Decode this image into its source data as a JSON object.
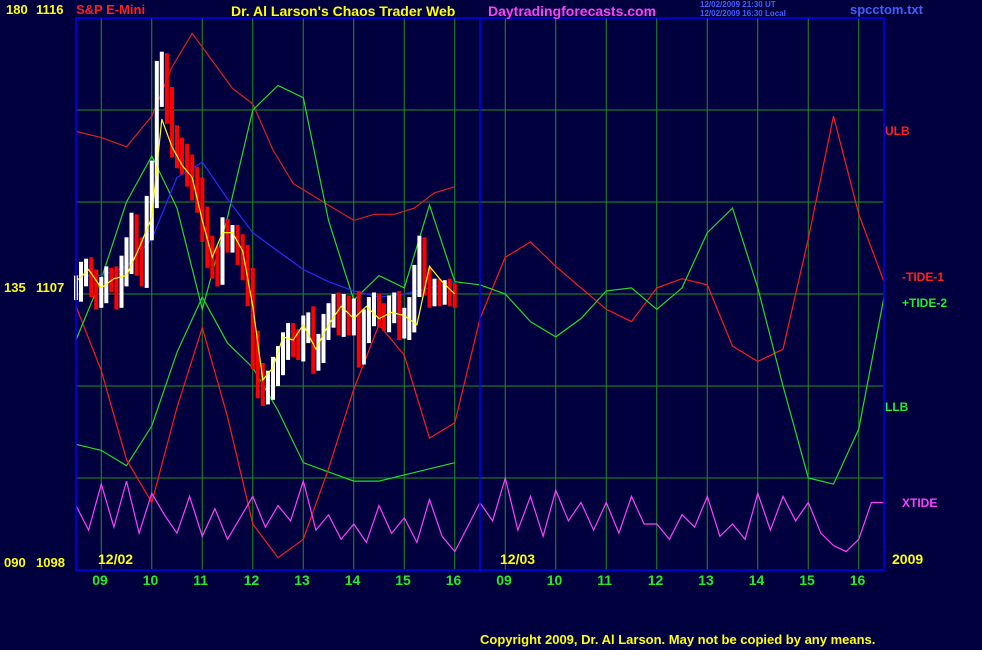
{
  "header": {
    "symbol": "S&P E-Mini",
    "title": "Dr. Al Larson's Chaos Trader Web",
    "site": "Daytradingforecasts.com",
    "timestamp_ut": "12/02/2009 21:30 UT",
    "timestamp_local": "12/02/2009 16:30 Local",
    "file": "spcctom.txt"
  },
  "y_labels": {
    "top_left": "180",
    "top_right": "1116",
    "mid_left": "135",
    "mid_right": "1107",
    "bottom_left": "090",
    "bottom_right": "1098"
  },
  "x_labels": {
    "day1": "12/02",
    "day2": "12/03",
    "year": "2009",
    "hours": [
      "09",
      "10",
      "11",
      "12",
      "13",
      "14",
      "15",
      "16",
      "09",
      "10",
      "11",
      "12",
      "13",
      "14",
      "15",
      "16"
    ]
  },
  "series_labels": {
    "ulb": "ULB",
    "tide1": "-TIDE-1",
    "tide2": "+TIDE-2",
    "llb": "LLB",
    "xtide": "XTIDE"
  },
  "footer": {
    "copyright": "Copyright 2009, Dr. Al Larson. May not be copied by any means."
  },
  "colors": {
    "background": "#00003f",
    "grid": "#1f8f1f",
    "frame": "#0000ff",
    "price_up": "#ffffff",
    "price_down": "#ff0000",
    "avg": "#ffff00",
    "tide1": "#ff1a1a",
    "tide2": "#22dd22",
    "ulb": "#dd2020",
    "llb": "#22dd22",
    "blue_avg": "#2a2aff",
    "xtide": "#ff40ff"
  },
  "chart_data": {
    "type": "line",
    "ylim": [
      1098,
      1116
    ],
    "x_domain_hours": [
      8.5,
      24.5
    ],
    "series": [
      {
        "key": "ulb",
        "name": "ULB",
        "x": [
          8.5,
          9.0,
          9.5,
          10.0,
          10.4,
          10.8,
          11.2,
          11.6,
          12.0,
          12.4,
          12.8,
          13.2,
          13.6,
          14.0,
          14.4,
          14.8,
          15.2,
          15.6,
          16.0
        ],
        "values": [
          1112.3,
          1112.1,
          1111.8,
          1112.8,
          1114.4,
          1115.5,
          1114.6,
          1113.7,
          1113.2,
          1111.7,
          1110.6,
          1110.2,
          1109.8,
          1109.4,
          1109.6,
          1109.6,
          1109.8,
          1110.3,
          1110.5
        ]
      },
      {
        "key": "llb",
        "name": "LLB",
        "x": [
          8.5,
          9.0,
          9.5,
          10.0,
          10.5,
          11.0,
          11.5,
          12.0,
          12.5,
          13.0,
          13.5,
          14.0,
          14.5,
          15.0,
          15.5,
          16.0
        ],
        "values": [
          1102.1,
          1101.9,
          1101.4,
          1102.7,
          1105.1,
          1106.9,
          1105.4,
          1104.6,
          1103.2,
          1101.5,
          1101.2,
          1100.9,
          1100.9,
          1101.1,
          1101.3,
          1101.5
        ]
      },
      {
        "key": "tide1",
        "name": "-TIDE-1",
        "x": [
          8.5,
          9.0,
          9.5,
          10.0,
          10.5,
          11.0,
          11.5,
          12.0,
          12.5,
          13.0,
          13.5,
          14.0,
          14.5,
          15.0,
          15.5,
          16.0,
          16.5,
          17.0,
          17.5,
          18.0,
          18.5,
          19.0,
          19.5,
          20.0,
          20.5,
          21.0,
          21.5,
          22.0,
          22.5,
          23.0,
          23.5,
          24.0,
          24.5
        ],
        "values": [
          1106.6,
          1104.5,
          1101.6,
          1100.2,
          1103.3,
          1105.9,
          1103.0,
          1099.5,
          1098.4,
          1099.0,
          1101.3,
          1103.9,
          1106.0,
          1105.0,
          1102.3,
          1102.8,
          1106.2,
          1108.2,
          1108.7,
          1107.9,
          1107.2,
          1106.5,
          1106.1,
          1107.2,
          1107.5,
          1107.3,
          1105.3,
          1104.8,
          1105.2,
          1108.8,
          1112.8,
          1109.6,
          1107.4
        ]
      },
      {
        "key": "tide2",
        "name": "+TIDE-2",
        "x": [
          8.5,
          9.0,
          9.5,
          10.0,
          10.5,
          11.0,
          11.5,
          12.0,
          12.5,
          13.0,
          13.5,
          14.0,
          14.5,
          15.0,
          15.5,
          16.0,
          16.5,
          17.0,
          17.5,
          18.0,
          18.5,
          19.0,
          19.5,
          20.0,
          20.5,
          21.0,
          21.5,
          22.0,
          22.5,
          23.0,
          23.5,
          24.0,
          24.5
        ],
        "values": [
          1105.5,
          1107.5,
          1110.0,
          1111.5,
          1109.8,
          1106.5,
          1109.5,
          1113.0,
          1113.8,
          1113.4,
          1109.4,
          1106.8,
          1107.6,
          1107.2,
          1109.9,
          1107.4,
          1107.3,
          1107.0,
          1106.1,
          1105.6,
          1106.2,
          1107.1,
          1107.2,
          1106.5,
          1107.2,
          1109.0,
          1109.8,
          1107.2,
          1104.0,
          1101.0,
          1100.8,
          1102.6,
          1106.9
        ]
      },
      {
        "key": "blue",
        "x": [
          8.5,
          9.0,
          9.5,
          10.0,
          10.5,
          11.0,
          11.5,
          12.0,
          12.5,
          13.0,
          13.5,
          14.0,
          14.5,
          15.0,
          15.5,
          16.0
        ],
        "values": [
          1107.6,
          1107.6,
          1107.9,
          1108.8,
          1110.8,
          1111.3,
          1110.1,
          1109.0,
          1108.4,
          1107.8,
          1107.4,
          1107.1,
          1106.9,
          1107.0,
          1107.2,
          1107.4
        ]
      },
      {
        "key": "xtide",
        "name": "XTIDE",
        "x": [
          8.5,
          8.75,
          9.0,
          9.25,
          9.5,
          9.75,
          10.0,
          10.25,
          10.5,
          10.75,
          11.0,
          11.25,
          11.5,
          11.75,
          12.0,
          12.25,
          12.5,
          12.75,
          13.0,
          13.25,
          13.5,
          13.75,
          14.0,
          14.25,
          14.5,
          14.75,
          15.0,
          15.25,
          15.5,
          15.75,
          16.0,
          16.25,
          16.5,
          16.75,
          17.0,
          17.25,
          17.5,
          17.75,
          18.0,
          18.25,
          18.5,
          18.75,
          19.0,
          19.25,
          19.5,
          19.75,
          20.0,
          20.25,
          20.5,
          20.75,
          21.0,
          21.25,
          21.5,
          21.75,
          22.0,
          22.25,
          22.5,
          22.75,
          23.0,
          23.25,
          23.5,
          23.75,
          24.0,
          24.25,
          24.5
        ],
        "values": [
          1100.1,
          1099.3,
          1100.8,
          1099.4,
          1100.9,
          1099.2,
          1100.5,
          1099.8,
          1099.2,
          1100.4,
          1099.1,
          1100.0,
          1099.0,
          1099.7,
          1100.4,
          1099.4,
          1100.1,
          1099.6,
          1100.9,
          1099.3,
          1099.8,
          1099.0,
          1099.5,
          1098.9,
          1100.1,
          1099.2,
          1099.7,
          1098.9,
          1100.3,
          1099.1,
          1098.6,
          1099.4,
          1100.2,
          1099.6,
          1101.0,
          1099.3,
          1100.4,
          1099.1,
          1100.6,
          1099.6,
          1100.2,
          1099.3,
          1100.2,
          1099.2,
          1100.4,
          1099.5,
          1099.5,
          1099.0,
          1099.8,
          1099.4,
          1100.4,
          1099.1,
          1099.5,
          1099.0,
          1100.5,
          1099.3,
          1100.4,
          1099.6,
          1100.2,
          1099.2,
          1098.8,
          1098.6,
          1099.0,
          1100.2,
          1100.2
        ]
      },
      {
        "key": "price_avg",
        "x": [
          8.5,
          8.75,
          9.0,
          9.25,
          9.5,
          9.75,
          10.0,
          10.2,
          10.4,
          10.6,
          10.8,
          11.0,
          11.2,
          11.4,
          11.6,
          11.8,
          12.0,
          12.2,
          12.4,
          12.6,
          12.8,
          13.0,
          13.25,
          13.5,
          13.75,
          14.0,
          14.25,
          14.5,
          14.75,
          15.0,
          15.25,
          15.5,
          15.75,
          16.0
        ],
        "values": [
          1107.4,
          1107.8,
          1107.2,
          1107.5,
          1107.6,
          1108.5,
          1109.5,
          1112.7,
          1111.8,
          1111.2,
          1110.8,
          1109.4,
          1108.2,
          1109.0,
          1109.0,
          1108.4,
          1106.6,
          1104.2,
          1104.6,
          1105.6,
          1105.5,
          1106.0,
          1105.2,
          1106.0,
          1106.6,
          1106.2,
          1106.6,
          1106.2,
          1106.4,
          1106.3,
          1106.0,
          1107.9,
          1107.4,
          1107.0
        ]
      }
    ],
    "price_bars": {
      "x": [
        8.5,
        8.6,
        8.7,
        8.8,
        8.9,
        9.0,
        9.1,
        9.2,
        9.3,
        9.4,
        9.5,
        9.6,
        9.7,
        9.8,
        9.9,
        10.0,
        10.1,
        10.2,
        10.3,
        10.4,
        10.5,
        10.6,
        10.7,
        10.8,
        10.9,
        11.0,
        11.1,
        11.2,
        11.3,
        11.4,
        11.5,
        11.6,
        11.7,
        11.8,
        11.9,
        12.0,
        12.1,
        12.2,
        12.3,
        12.4,
        12.5,
        12.6,
        12.7,
        12.8,
        12.9,
        13.0,
        13.1,
        13.2,
        13.3,
        13.4,
        13.5,
        13.6,
        13.7,
        13.8,
        13.9,
        14.0,
        14.1,
        14.2,
        14.3,
        14.4,
        14.5,
        14.6,
        14.7,
        14.8,
        14.9,
        15.0,
        15.1,
        15.2,
        15.3,
        15.4,
        15.5,
        15.6,
        15.7,
        15.8,
        15.9,
        16.0
      ],
      "close": [
        1107.2,
        1107.6,
        1107.8,
        1107.3,
        1107.0,
        1107.1,
        1107.5,
        1107.4,
        1107.0,
        1107.8,
        1108.3,
        1109.0,
        1108.2,
        1107.9,
        1109.5,
        1110.6,
        1113.8,
        1114.2,
        1113.2,
        1112.0,
        1111.6,
        1111.4,
        1111.0,
        1110.6,
        1110.2,
        1109.3,
        1108.4,
        1108.0,
        1107.8,
        1109.0,
        1108.8,
        1108.8,
        1108.4,
        1108.0,
        1107.2,
        1105.2,
        1104.2,
        1103.9,
        1104.0,
        1104.5,
        1104.8,
        1105.3,
        1105.6,
        1105.4,
        1105.3,
        1105.8,
        1106.0,
        1105.0,
        1105.2,
        1105.9,
        1106.3,
        1106.6,
        1106.1,
        1106.5,
        1106.1,
        1106.4,
        1105.3,
        1105.9,
        1106.4,
        1106.6,
        1106.3,
        1106.2,
        1106.5,
        1106.6,
        1106.0,
        1106.1,
        1106.3,
        1107.4,
        1108.4,
        1107.4,
        1107.0,
        1107.1,
        1107.0,
        1107.1,
        1107.0,
        1106.9
      ],
      "range": [
        0.8,
        0.9,
        0.7,
        0.8,
        1.0,
        0.9,
        0.8,
        0.7,
        1.0,
        0.9,
        1.1,
        1.3,
        1.2,
        1.3,
        1.4,
        1.5,
        1.6,
        1.4,
        1.3,
        1.1,
        1.0,
        1.0,
        1.0,
        1.1,
        1.1,
        1.2,
        1.1,
        1.0,
        1.1,
        1.0,
        0.9,
        0.9,
        0.9,
        1.1,
        1.2,
        1.3,
        1.2,
        1.1,
        1.0,
        0.9,
        1.0,
        0.9,
        0.9,
        0.9,
        0.9,
        1.0,
        0.8,
        1.2,
        1.0,
        0.9,
        0.8,
        0.8,
        0.9,
        1.0,
        0.9,
        0.9,
        1.4,
        1.2,
        1.0,
        0.9,
        0.8,
        0.8,
        0.9,
        0.9,
        1.0,
        0.9,
        1.2,
        1.1,
        1.0,
        0.9,
        0.9,
        0.8,
        0.8,
        0.7,
        0.8,
        0.7
      ]
    }
  }
}
